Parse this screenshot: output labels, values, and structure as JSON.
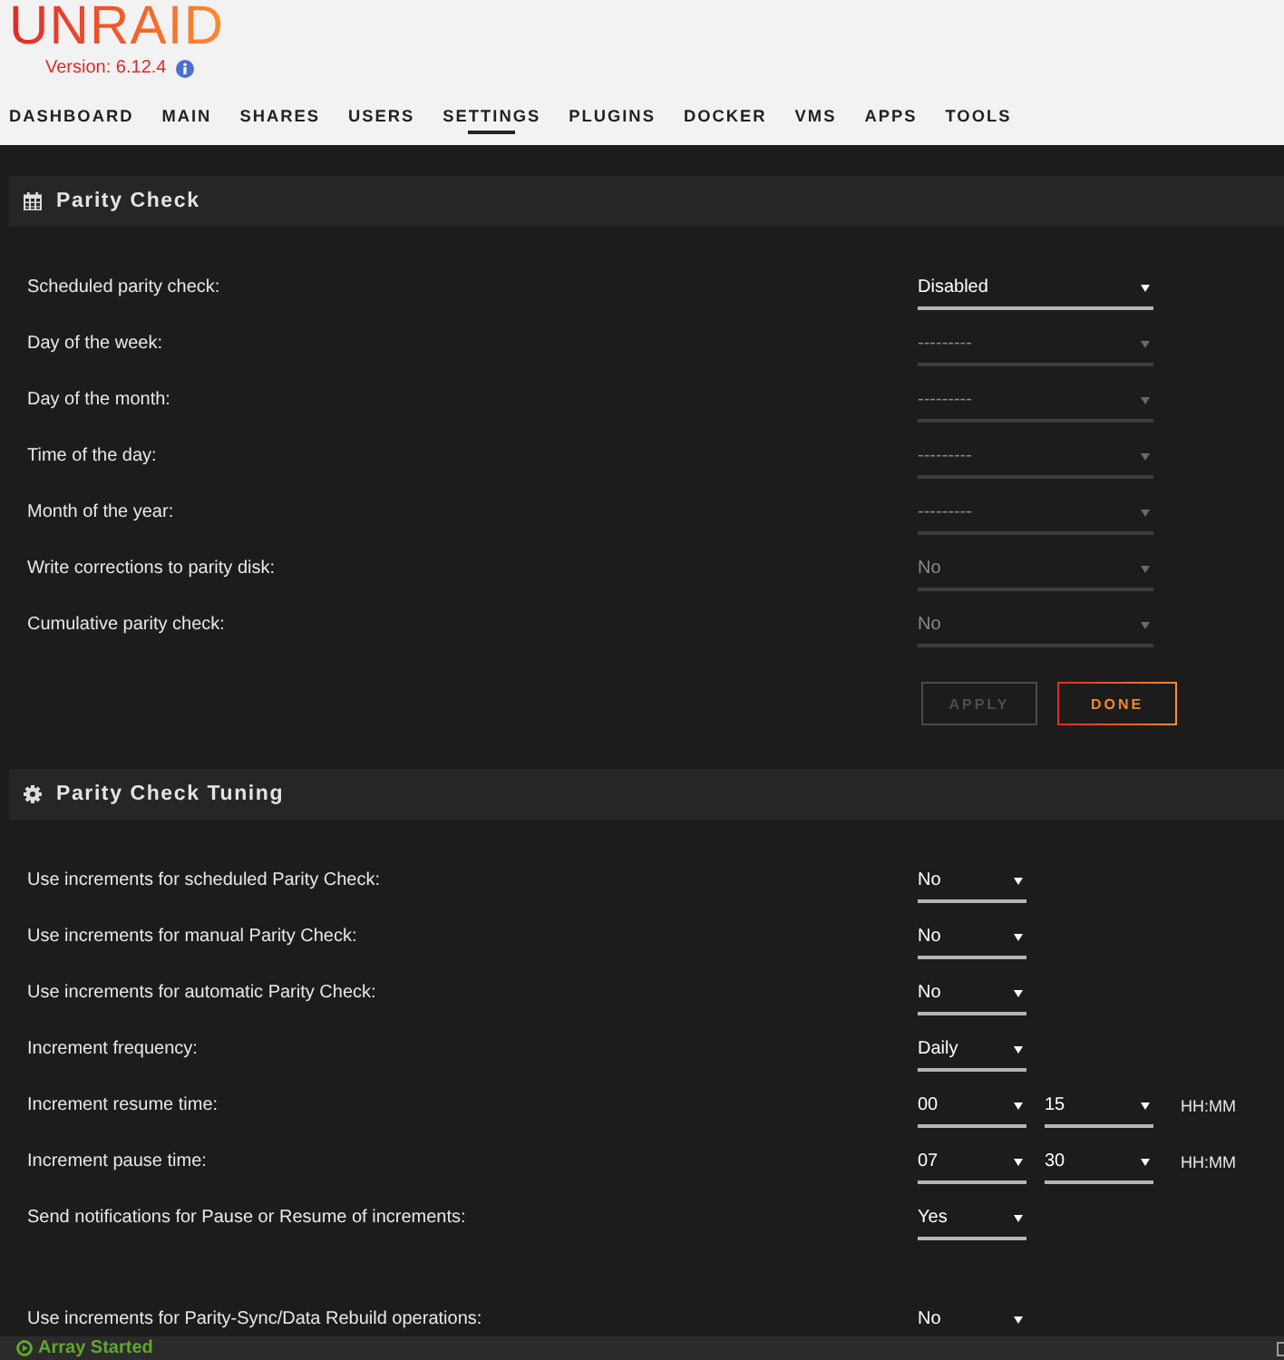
{
  "logo": {
    "text": "UNRAID"
  },
  "version": {
    "text": "Version: 6.12.4"
  },
  "nav": [
    {
      "label": "DASHBOARD",
      "selected": false
    },
    {
      "label": "MAIN",
      "selected": false
    },
    {
      "label": "SHARES",
      "selected": false
    },
    {
      "label": "USERS",
      "selected": false
    },
    {
      "label": "SETTINGS",
      "selected": true
    },
    {
      "label": "PLUGINS",
      "selected": false
    },
    {
      "label": "DOCKER",
      "selected": false
    },
    {
      "label": "VMS",
      "selected": false
    },
    {
      "label": "APPS",
      "selected": false
    },
    {
      "label": "TOOLS",
      "selected": false
    }
  ],
  "sections": [
    {
      "kind": "schedule",
      "title": "Parity Check",
      "groups": [
        [
          {
            "label": "Scheduled parity check:",
            "selects": [
              {
                "value": "Disabled",
                "disabled": false
              }
            ]
          },
          {
            "label": "Day of the week:",
            "selects": [
              {
                "value": "---------",
                "disabled": true
              }
            ]
          },
          {
            "label": "Day of the month:",
            "selects": [
              {
                "value": "---------",
                "disabled": true
              }
            ]
          },
          {
            "label": "Time of the day:",
            "selects": [
              {
                "value": "---------",
                "disabled": true
              }
            ]
          },
          {
            "label": "Month of the year:",
            "selects": [
              {
                "value": "---------",
                "disabled": true
              }
            ]
          },
          {
            "label": "Write corrections to parity disk:",
            "selects": [
              {
                "value": "No",
                "disabled": true
              }
            ]
          },
          {
            "label": "Cumulative parity check:",
            "selects": [
              {
                "value": "No",
                "disabled": true
              }
            ]
          }
        ]
      ],
      "buttons": [
        {
          "label": "APPLY",
          "disabled": true
        },
        {
          "label": "DONE",
          "disabled": false
        }
      ]
    },
    {
      "kind": "tuning",
      "title": "Parity Check Tuning",
      "groups": [
        [
          {
            "label": "Use increments for scheduled Parity Check:",
            "selects": [
              {
                "value": "No",
                "disabled": false
              }
            ]
          },
          {
            "label": "Use increments for manual Parity Check:",
            "selects": [
              {
                "value": "No",
                "disabled": false
              }
            ]
          },
          {
            "label": "Use increments for automatic Parity Check:",
            "selects": [
              {
                "value": "No",
                "disabled": false
              }
            ]
          },
          {
            "label": "Increment frequency:",
            "selects": [
              {
                "value": "Daily",
                "disabled": false
              }
            ]
          },
          {
            "label": "Increment resume time:",
            "selects": [
              {
                "value": "00",
                "disabled": false
              },
              {
                "value": "15",
                "disabled": false
              }
            ],
            "suffix": "HH:MM"
          },
          {
            "label": "Increment pause time:",
            "selects": [
              {
                "value": "07",
                "disabled": false
              },
              {
                "value": "30",
                "disabled": false
              }
            ],
            "suffix": "HH:MM"
          },
          {
            "label": "Send notifications for Pause or Resume of increments:",
            "selects": [
              {
                "value": "Yes",
                "disabled": false
              }
            ]
          }
        ],
        [
          {
            "label": "Use increments for Parity-Sync/Data Rebuild operations:",
            "selects": [
              {
                "value": "No",
                "disabled": false
              }
            ]
          }
        ]
      ]
    }
  ],
  "status_bar": {
    "text": "Array Started"
  }
}
